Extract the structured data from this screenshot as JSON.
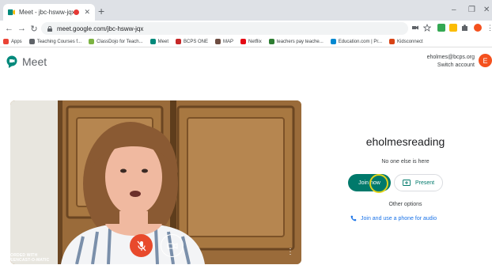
{
  "browser": {
    "tab_title": "Meet - jbc-hsww-jqx",
    "tab_close": "✕",
    "new_tab": "+",
    "window_min": "–",
    "window_max": "❐",
    "window_close": "✕",
    "url": "meet.google.com/jbc-hsww-jqx",
    "back": "←",
    "forward": "→",
    "reload": "↻",
    "bookmarks": [
      {
        "label": "Apps",
        "color": "#ea4335"
      },
      {
        "label": "Teaching Courses f...",
        "color": "#5f6368"
      },
      {
        "label": "ClassDojo for Teach...",
        "color": "#7cb342"
      },
      {
        "label": "Meet",
        "color": "#00897b"
      },
      {
        "label": "BCPS ONE",
        "color": "#c62828"
      },
      {
        "label": "MAP",
        "color": "#6d4c41"
      },
      {
        "label": "Netflix",
        "color": "#e50914"
      },
      {
        "label": "teachers pay teache...",
        "color": "#2e7d32"
      },
      {
        "label": "Education.com | Pr...",
        "color": "#0288d1"
      },
      {
        "label": "Kidsconnect",
        "color": "#d84315"
      }
    ]
  },
  "meet": {
    "app_name": "Meet",
    "account_email": "eholmes@bcps.org",
    "switch_account": "Switch account",
    "avatar_letter": "E",
    "room_name": "eholmesreading",
    "status": "No one else is here",
    "join_label": "Join now",
    "present_label": "Present",
    "other_options": "Other options",
    "phone_option": "Join and use a phone for audio"
  },
  "video": {
    "more": "⋮",
    "watermark_line1": "RECORDED WITH",
    "watermark_line2": "SCREENCAST-O-MATIC"
  },
  "colors": {
    "accent": "#00796b",
    "mic_off": "#e84a2c",
    "avatar": "#f4511e",
    "link": "#1a73e8"
  }
}
